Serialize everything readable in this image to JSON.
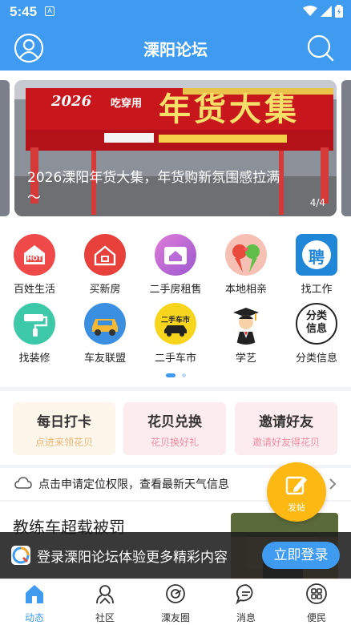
{
  "status": {
    "time": "5:45",
    "app_badge": "A"
  },
  "header": {
    "title": "溧阳论坛",
    "left_icon": "user-icon",
    "right_icon": "search-icon"
  },
  "banner": {
    "caption": "2026溧阳年货大集，年货购新氛围感拉满～",
    "page_indicator": "4/4",
    "sign_text": "年货大集",
    "sign_year": "2026",
    "sign_small": "吃穿用"
  },
  "grid": {
    "items": [
      {
        "label": "百姓生活",
        "icon": "hot-icon",
        "color": "#f0494a",
        "glyph": "HOT"
      },
      {
        "label": "买新房",
        "icon": "house-icon",
        "color": "#e8403a",
        "glyph": ""
      },
      {
        "label": "二手房租售",
        "icon": "second-house-icon",
        "color": "#b86bd8",
        "glyph": ""
      },
      {
        "label": "本地相亲",
        "icon": "parrots-icon",
        "color": "#f08a7a",
        "glyph": ""
      },
      {
        "label": "找工作",
        "icon": "job-icon",
        "color": "#1f86d8",
        "glyph": "聘"
      },
      {
        "label": "找装修",
        "icon": "paint-roller-icon",
        "color": "#3dc9a8",
        "glyph": ""
      },
      {
        "label": "车友联盟",
        "icon": "car-icon",
        "color": "#3a8fe0",
        "glyph": ""
      },
      {
        "label": "二手车市",
        "icon": "used-car-icon",
        "color": "#f7d51c",
        "glyph": "二手车市"
      },
      {
        "label": "学艺",
        "icon": "graduate-icon",
        "color": "#ffffff",
        "glyph": ""
      },
      {
        "label": "分类信息",
        "icon": "category-info-icon",
        "color": "#ffffff",
        "glyph": "分类信息"
      }
    ]
  },
  "cards": [
    {
      "title": "每日打卡",
      "subtitle": "点进来领花贝",
      "bg": "#fdf6ea",
      "sub_color": "#e8b77a"
    },
    {
      "title": "花贝兑换",
      "subtitle": "花贝换好礼",
      "bg": "#fcecef",
      "sub_color": "#ee8fa3"
    },
    {
      "title": "邀请好友",
      "subtitle": "邀请好友得花贝",
      "bg": "#fcecef",
      "sub_color": "#ee8fa3"
    }
  ],
  "weather": {
    "text": "点击申请定位权限，查看最新天气信息",
    "icon": "cloud-icon"
  },
  "fab": {
    "label": "发帖",
    "icon": "edit-icon"
  },
  "article": {
    "title": "教练车超载被罚"
  },
  "login_bar": {
    "text": "登录溧阳论坛体验更多精彩内容",
    "button": "立即登录"
  },
  "tabs": [
    {
      "label": "动态",
      "icon": "home-icon",
      "active": true
    },
    {
      "label": "社区",
      "icon": "community-icon",
      "active": false
    },
    {
      "label": "溧友圈",
      "icon": "friends-circle-icon",
      "active": false
    },
    {
      "label": "消息",
      "icon": "message-icon",
      "active": false
    },
    {
      "label": "便民",
      "icon": "services-icon",
      "active": false
    }
  ],
  "colors": {
    "primary": "#3e9bef",
    "fab": "#fdb813",
    "tab_inactive": "#333333"
  }
}
